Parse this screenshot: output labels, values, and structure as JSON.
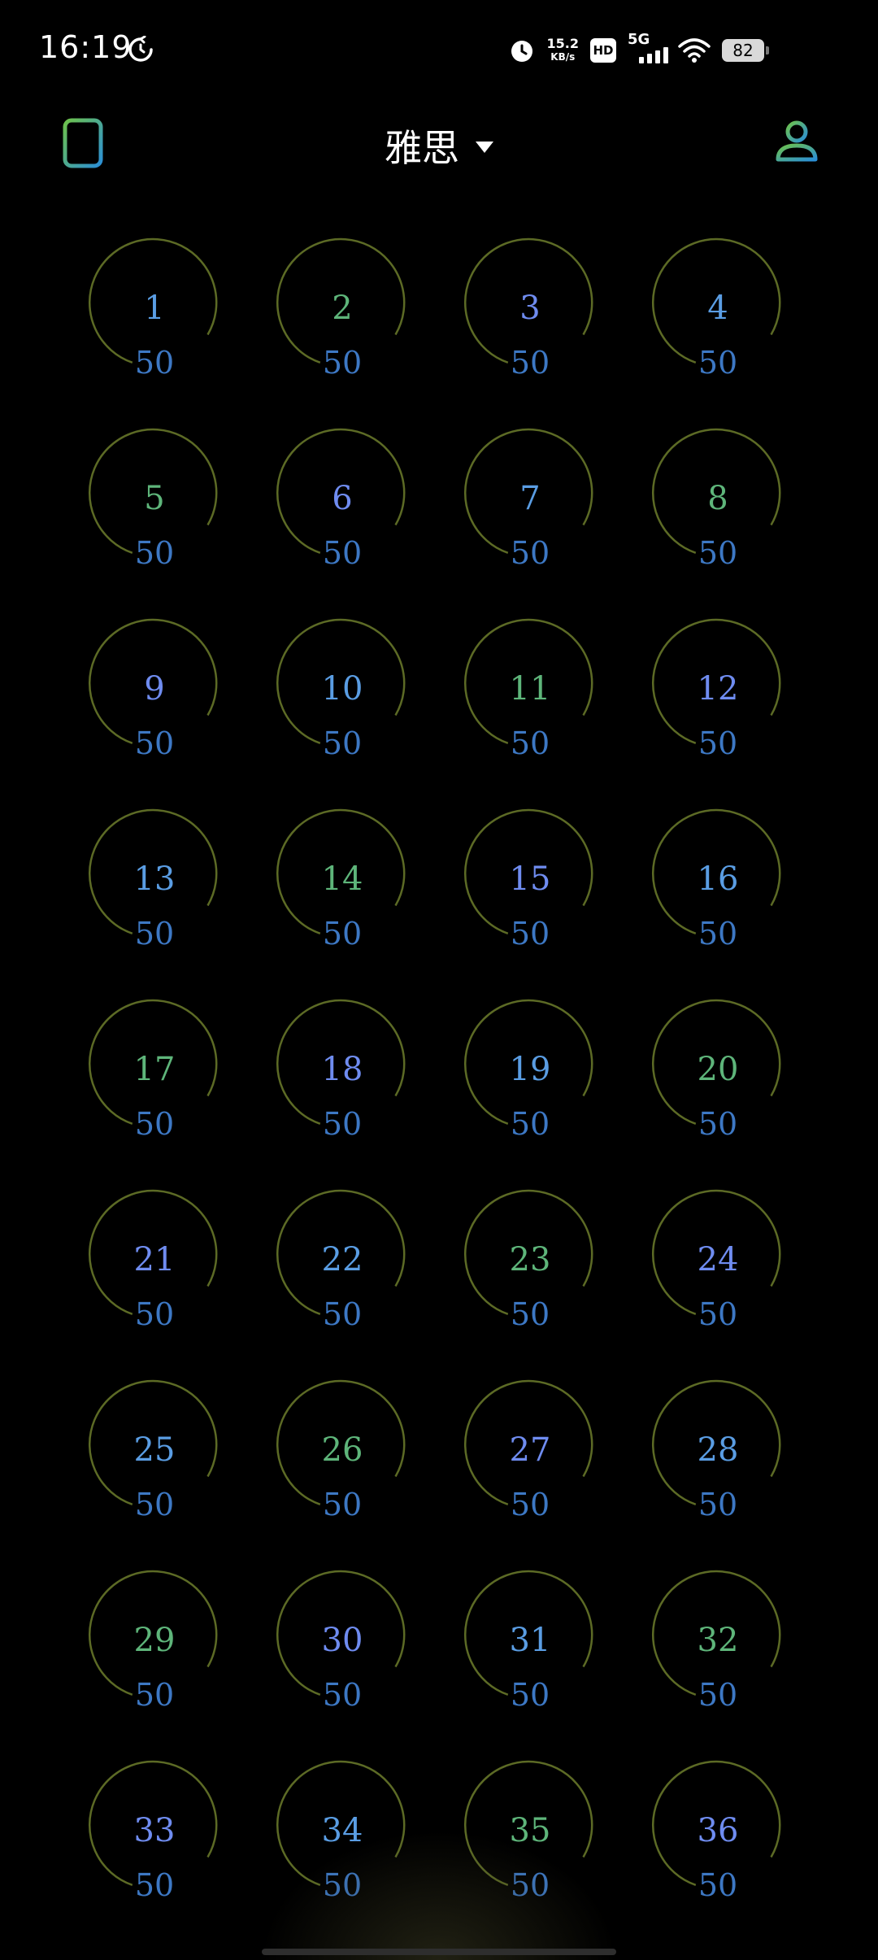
{
  "status_bar": {
    "time": "16:19",
    "net_speed_value": "15.2",
    "net_speed_unit": "KB/s",
    "hd_label": "HD",
    "network_label": "5G",
    "battery": "82"
  },
  "header": {
    "title": "雅思",
    "menu_icon": "document-list-icon",
    "profile_icon": "user-profile-icon"
  },
  "colors": {
    "ring": "#5c6a25",
    "count": "#3d78c4",
    "accent_blue": "#5a9de3",
    "accent_green": "#5eb57a",
    "icon_gradient_start": "#6dc24b",
    "icon_gradient_end": "#2b8fd6"
  },
  "units": [
    {
      "number": "1",
      "count": "50"
    },
    {
      "number": "2",
      "count": "50"
    },
    {
      "number": "3",
      "count": "50"
    },
    {
      "number": "4",
      "count": "50"
    },
    {
      "number": "5",
      "count": "50"
    },
    {
      "number": "6",
      "count": "50"
    },
    {
      "number": "7",
      "count": "50"
    },
    {
      "number": "8",
      "count": "50"
    },
    {
      "number": "9",
      "count": "50"
    },
    {
      "number": "10",
      "count": "50"
    },
    {
      "number": "11",
      "count": "50"
    },
    {
      "number": "12",
      "count": "50"
    },
    {
      "number": "13",
      "count": "50"
    },
    {
      "number": "14",
      "count": "50"
    },
    {
      "number": "15",
      "count": "50"
    },
    {
      "number": "16",
      "count": "50"
    },
    {
      "number": "17",
      "count": "50"
    },
    {
      "number": "18",
      "count": "50"
    },
    {
      "number": "19",
      "count": "50"
    },
    {
      "number": "20",
      "count": "50"
    },
    {
      "number": "21",
      "count": "50"
    },
    {
      "number": "22",
      "count": "50"
    },
    {
      "number": "23",
      "count": "50"
    },
    {
      "number": "24",
      "count": "50"
    },
    {
      "number": "25",
      "count": "50"
    },
    {
      "number": "26",
      "count": "50"
    },
    {
      "number": "27",
      "count": "50"
    },
    {
      "number": "28",
      "count": "50"
    },
    {
      "number": "29",
      "count": "50"
    },
    {
      "number": "30",
      "count": "50"
    },
    {
      "number": "31",
      "count": "50"
    },
    {
      "number": "32",
      "count": "50"
    },
    {
      "number": "33",
      "count": "50"
    },
    {
      "number": "34",
      "count": "50"
    },
    {
      "number": "35",
      "count": "50"
    },
    {
      "number": "36",
      "count": "50"
    }
  ]
}
